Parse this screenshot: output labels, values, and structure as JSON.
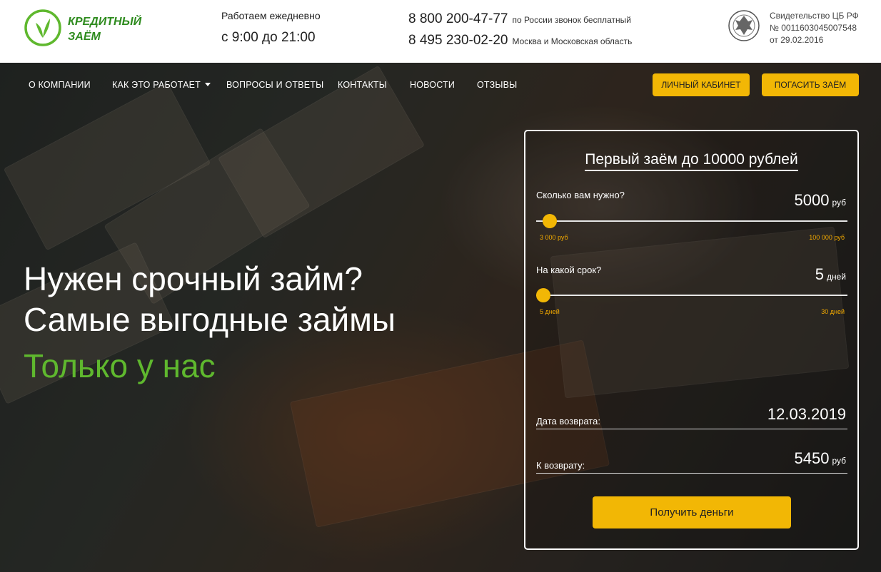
{
  "header": {
    "logo": {
      "line1": "КРЕДИТНЫЙ",
      "line2": "ЗАЁМ"
    },
    "hours": {
      "label": "Работаем ежедневно",
      "time": "с 9:00 до 21:00"
    },
    "phones": [
      {
        "number": "8 800 200-47-77",
        "note": "по России звонок бесплатный"
      },
      {
        "number": "8 495 230-02-20",
        "note": "Москва и Московская область"
      }
    ],
    "license": {
      "line1": "Свидетельство ЦБ РФ",
      "line2": "№ 0011603045007548",
      "line3": "от 29.02.2016"
    }
  },
  "nav": {
    "items": [
      "О КОМПАНИИ",
      "КАК ЭТО РАБОТАЕТ",
      "ВОПРОСЫ И ОТВЕТЫ",
      "КОНТАКТЫ",
      "НОВОСТИ",
      "ОТЗЫВЫ"
    ],
    "cabinet_label": "ЛИЧНЫЙ КАБИНЕТ",
    "repay_label": "ПОГАСИТЬ ЗАЁМ"
  },
  "hero": {
    "line1": "Нужен срочный займ?",
    "line2": "Самые выгодные займы",
    "accent": "Только у нас"
  },
  "calculator": {
    "title": "Первый заём до 10000 рублей",
    "amount": {
      "label": "Сколько вам нужно?",
      "value": "5000",
      "unit": "руб",
      "min_label": "3 000 руб",
      "max_label": "100 000 руб",
      "min": 3000,
      "max": 100000,
      "current": 5000
    },
    "term": {
      "label": "На какой срок?",
      "value": "5",
      "unit": "дней",
      "min_label": "5 дней",
      "max_label": "30 дней",
      "min": 5,
      "max": 30,
      "current": 5
    },
    "return_date": {
      "label": "Дата возврата:",
      "value": "12.03.2019"
    },
    "return_amount": {
      "label": "К возврату:",
      "value": "5450",
      "unit": "руб"
    },
    "submit_label": "Получить деньги"
  },
  "colors": {
    "accent": "#f2b705",
    "brand_green": "#5fb82e"
  }
}
